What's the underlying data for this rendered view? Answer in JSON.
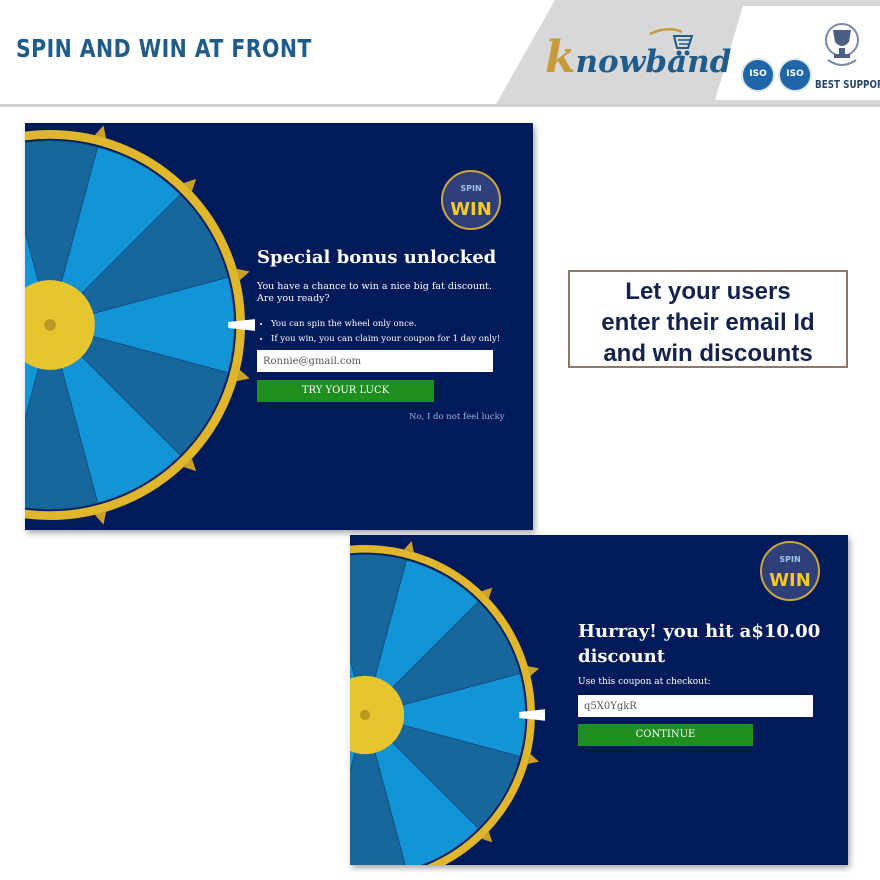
{
  "header": {
    "title": "SPIN AND WIN AT FRONT",
    "brand": "nowband",
    "brand_initial": "k",
    "badges": [
      "ISO",
      "ISO"
    ],
    "support_label": "BEST SUPPORT",
    "title_color": "#1f5c8b"
  },
  "callout": {
    "lines": [
      "Let your users",
      "enter their email Id",
      "and win discounts"
    ]
  },
  "popup_signup": {
    "logo_text": "WIN",
    "logo_top_text": "SPIN",
    "heading": "Special bonus unlocked",
    "description": "You have a chance to win a nice big fat discount. Are you ready?",
    "rules": [
      "You can spin the wheel only once.",
      "If you win, you can claim your coupon for 1 day only!"
    ],
    "email_value": "Ronnie@gmail.com",
    "try_button": "TRY YOUR LUCK",
    "decline_link": "No, I do not feel lucky"
  },
  "popup_result": {
    "logo_text": "WIN",
    "logo_top_text": "SPIN",
    "heading": "Hurray! you hit a$10.00 discount",
    "coupon_label": "Use this coupon at checkout:",
    "coupon_value": "q5X0YgkR",
    "continue_button": "CONTINUE"
  },
  "colors": {
    "panel_bg": "#001a5a",
    "wheel_light": "#1294d6",
    "wheel_dark": "#17679e",
    "wheel_rim": "#e0b62c",
    "button_green": "#1f8f1f"
  }
}
